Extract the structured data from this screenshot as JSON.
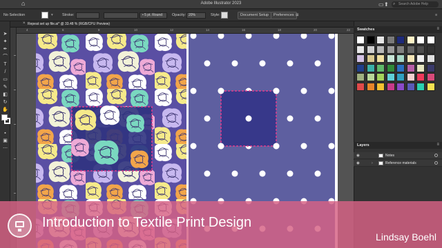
{
  "app": {
    "title": "Adobe Illustrator 2023",
    "search_placeholder": "Search Adobe Help"
  },
  "control_bar": {
    "selection_label": "No Selection",
    "stroke_label": "Stroke:",
    "brush_label": "5 pt. Round",
    "opacity_label": "Opacity:",
    "opacity_value": "20%",
    "style_label": "Style:",
    "document_setup_button": "Document Setup",
    "preferences_button": "Preferences"
  },
  "document": {
    "tab_title": "Repeat set up file.ai* @ 33.48 % (RGB/CPU Preview)",
    "ruler_ticks": [
      "4",
      "6",
      "8",
      "10",
      "12",
      "14",
      "16",
      "18",
      "20",
      "22"
    ],
    "pattern_background": "#5a4fa3",
    "polka_background": "#5e5fa0",
    "polka_dot_color": "#ffffff",
    "selection_square_color": "#37388a",
    "selection_outline_color": "#e03a8c"
  },
  "panels": {
    "swatches": {
      "title": "Swatches",
      "colors": [
        "#ffffff",
        "#000000",
        "#e6e6e6",
        "#7a7a7a",
        "#1e2a7a",
        "#fff3c7",
        "#ffffff",
        "#ffffff",
        "#e8e8e8",
        "#d0d0d0",
        "#b8b8b8",
        "#9a9a9a",
        "#808080",
        "#666666",
        "#4d4d4d",
        "#333333",
        "#d4c3e6",
        "#d9c98f",
        "#f0e0a0",
        "#c8e6d8",
        "#a8d8c8",
        "#f5e6b8",
        "#f0f0f0",
        "#e0e0e0",
        "#1f3e8a",
        "#3ab0a8",
        "#5fb86a",
        "#2f8a3a",
        "#2a6fc0",
        "#b85fa8",
        "#e6e6c0",
        "#3a3a6a",
        "#9fb080",
        "#b8d898",
        "#a3d35a",
        "#5fd0d8",
        "#30a0c0",
        "#f5d0d0",
        "#f03a5a",
        "#d84a7a",
        "#e04a4a",
        "#e8862a",
        "#f5c030",
        "#c83a8a",
        "#8a4ac8",
        "#5a5ab8",
        "#2ad0b0",
        "#f5e050"
      ]
    },
    "layers": {
      "title": "Layers",
      "items": [
        {
          "name": "Notes"
        },
        {
          "name": "Reference materials"
        }
      ]
    }
  },
  "overlay": {
    "course_title": "Introduction to Textile Print Design",
    "author": "Lindsay Boehl"
  }
}
